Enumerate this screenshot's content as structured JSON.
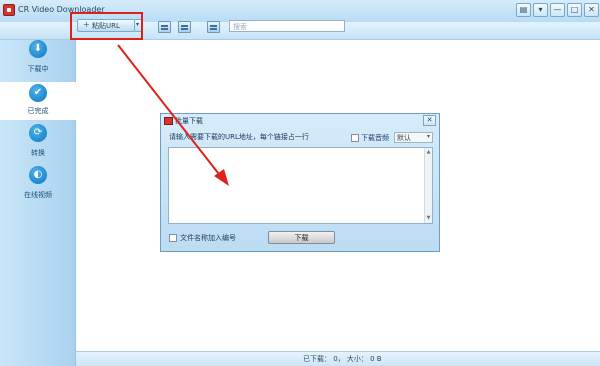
{
  "app": {
    "title": "CR Video Downloader"
  },
  "window_controls": {
    "skin": "▤",
    "menu": "▾",
    "minimize": "—",
    "maximize": "□",
    "close": "✕"
  },
  "toolbar": {
    "paste_label": "粘贴URL",
    "paste_plus": "+",
    "dropdown": "▾",
    "search_placeholder": "搜索"
  },
  "sidebar": {
    "items": [
      {
        "label": "下载中",
        "icon": "download-icon",
        "glyph": "⬇"
      },
      {
        "label": "已完成",
        "icon": "check-icon",
        "glyph": "✔"
      },
      {
        "label": "转换",
        "icon": "convert-icon",
        "glyph": "⟳"
      },
      {
        "label": "在线视频",
        "icon": "globe-icon",
        "glyph": "◐"
      }
    ]
  },
  "status": {
    "text": "已下载： 0， 大小： 0 B"
  },
  "dialog": {
    "title": "批量下载",
    "close": "✕",
    "prompt": "请输入需要下载的URL地址，每个链接占一行",
    "audio_label": "下载音频",
    "quality_value": "默认",
    "quality_caret": "▾",
    "scroll_up": "▲",
    "scroll_down": "▼",
    "filename_label": "文件名称加入编号",
    "download_button": "下载"
  },
  "colors": {
    "highlight": "#e0201a",
    "accent": "#0b77c2"
  }
}
